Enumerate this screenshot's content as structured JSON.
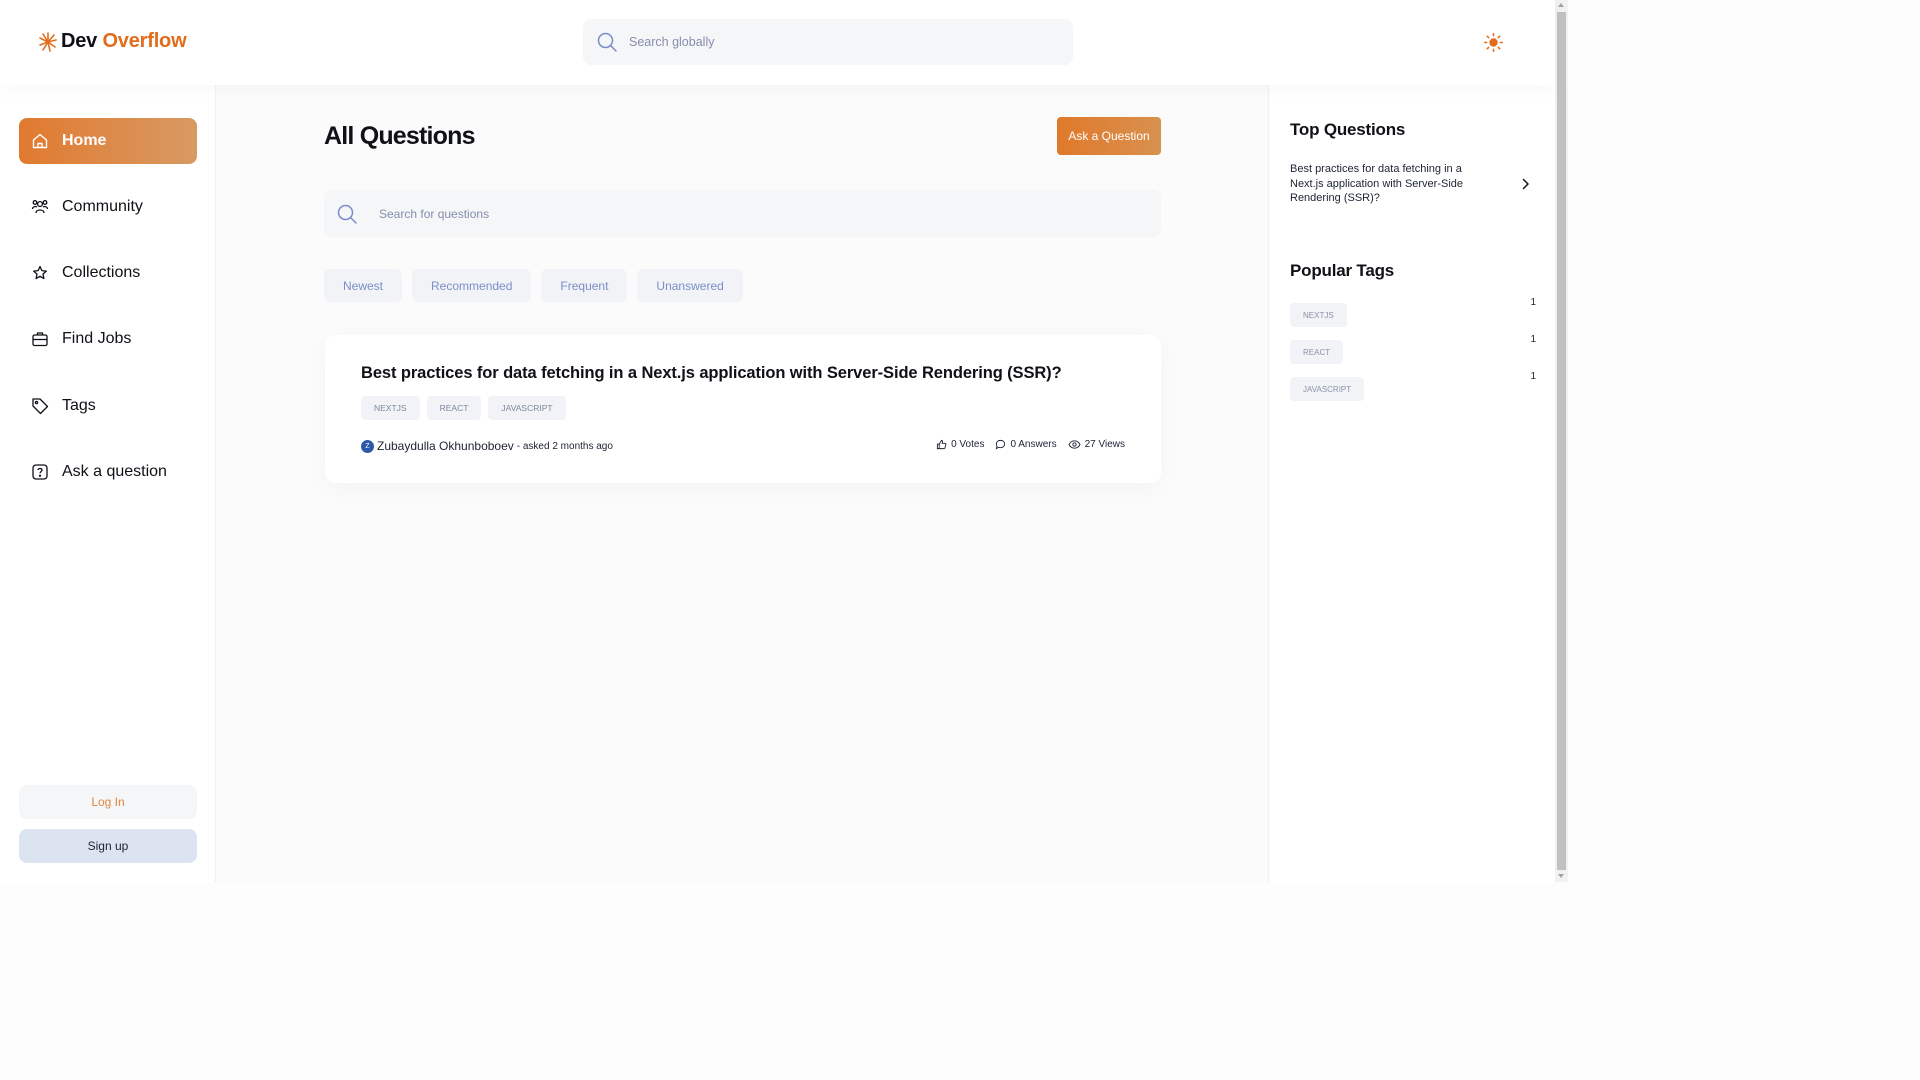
{
  "app": {
    "logo_first": "Dev",
    "logo_second": "Overflow",
    "global_search_placeholder": "Search globally"
  },
  "sidebar": {
    "items": [
      {
        "label": "Home",
        "icon": "home-icon",
        "active": true
      },
      {
        "label": "Community",
        "icon": "users-icon",
        "active": false
      },
      {
        "label": "Collections",
        "icon": "star-icon",
        "active": false
      },
      {
        "label": "Find Jobs",
        "icon": "briefcase-icon",
        "active": false
      },
      {
        "label": "Tags",
        "icon": "tag-icon",
        "active": false
      },
      {
        "label": "Ask a question",
        "icon": "question-icon",
        "active": false
      }
    ],
    "login_label": "Log In",
    "signup_label": "Sign up"
  },
  "main": {
    "title": "All Questions",
    "ask_button": "Ask a Question",
    "search_placeholder": "Search for questions",
    "filters": [
      "Newest",
      "Recommended",
      "Frequent",
      "Unanswered"
    ],
    "questions": [
      {
        "title": "Best practices for data fetching in a Next.js application with Server-Side Rendering (SSR)?",
        "tags": [
          "NEXTJS",
          "REACT",
          "JAVASCRIPT"
        ],
        "author_initial": "Z",
        "author": "Zubaydulla Okhunboboev",
        "asked": "- asked 2 months ago",
        "votes": "0 Votes",
        "answers": "0 Answers",
        "views": "27 Views"
      }
    ]
  },
  "right_sidebar": {
    "top_questions_title": "Top Questions",
    "top_questions": [
      "Best practices for data fetching in a Next.js application with Server-Side Rendering (SSR)?"
    ],
    "popular_tags_title": "Popular Tags",
    "popular_tags": [
      {
        "name": "NEXTJS",
        "count": "1"
      },
      {
        "name": "REACT",
        "count": "1"
      },
      {
        "name": "JAVASCRIPT",
        "count": "1"
      }
    ]
  },
  "colors": {
    "accent": "#e26c1b",
    "accent_gradient_end": "#d89a63",
    "filter_text": "#7b8ec8"
  }
}
